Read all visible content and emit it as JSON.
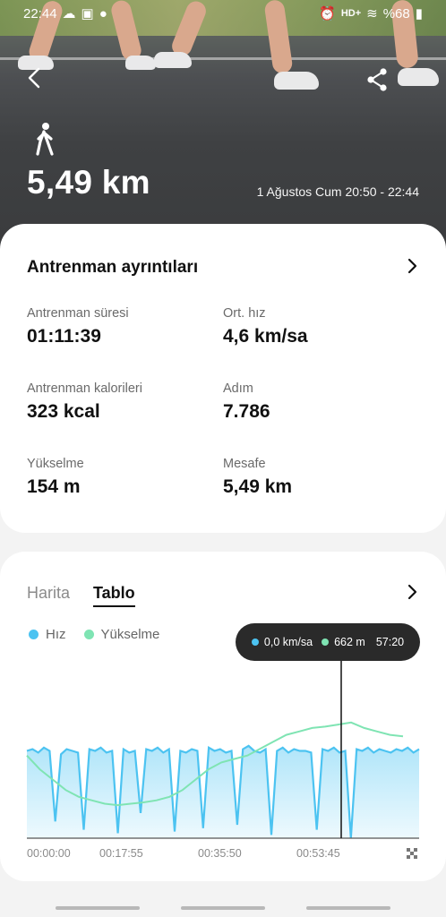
{
  "status": {
    "time": "22:44",
    "battery": "%68",
    "network": "HD+"
  },
  "hero": {
    "distance": "5,49 km",
    "date_range": "1 Ağustos Cum 20:50 - 22:44"
  },
  "details": {
    "title": "Antrenman ayrıntıları",
    "stats": [
      {
        "label": "Antrenman süresi",
        "value": "01:11:39"
      },
      {
        "label": "Ort. hız",
        "value": "4,6 km/sa"
      },
      {
        "label": "Antrenman kalorileri",
        "value": "323 kcal"
      },
      {
        "label": "Adım",
        "value": "7.786"
      },
      {
        "label": "Yükselme",
        "value": "154 m"
      },
      {
        "label": "Mesafe",
        "value": "5,49 km"
      }
    ]
  },
  "graph": {
    "tabs": {
      "map": "Harita",
      "table": "Tablo"
    },
    "legend": {
      "speed": "Hız",
      "elevation": "Yükselme"
    },
    "tooltip": {
      "speed": "0,0 km/sa",
      "elevation": "662 m",
      "time": "57:20"
    },
    "colors": {
      "speed": "#4cc3f1",
      "elevation": "#7fe4b3"
    }
  },
  "chart_data": {
    "type": "area",
    "x_ticks": [
      "00:00:00",
      "00:17:55",
      "00:35:50",
      "00:53:45"
    ],
    "series": [
      {
        "name": "Hız",
        "values": [
          5.2,
          5.3,
          5.1,
          5.4,
          5.2,
          1.0,
          5.0,
          5.3,
          5.2,
          5.1,
          0.5,
          5.3,
          5.2,
          5.4,
          5.1,
          5.2,
          0.3,
          5.3,
          5.1,
          5.2,
          1.5,
          5.3,
          5.2,
          5.4,
          5.1,
          5.3,
          0.4,
          5.2,
          5.1,
          5.3,
          5.2,
          0.6,
          5.4,
          5.2,
          5.3,
          5.1,
          5.2,
          0.8,
          5.3,
          5.5,
          5.2,
          5.1,
          5.3,
          0.2,
          5.2,
          5.4,
          5.1,
          5.3,
          5.2,
          5.2,
          5.1,
          0.5,
          5.3,
          5.2,
          5.4,
          5.1,
          5.2,
          0.0,
          5.3,
          5.2,
          5.4,
          5.1,
          5.3,
          5.2,
          5.1,
          5.3,
          5.2,
          5.4,
          5.1,
          5.3
        ]
      },
      {
        "name": "Yükselme",
        "values": [
          620,
          600,
          585,
          570,
          560,
          555,
          550,
          548,
          550,
          552,
          555,
          560,
          570,
          585,
          600,
          610,
          615,
          620,
          630,
          640,
          650,
          655,
          660,
          662,
          665,
          668,
          660,
          655,
          650,
          648
        ]
      }
    ]
  }
}
